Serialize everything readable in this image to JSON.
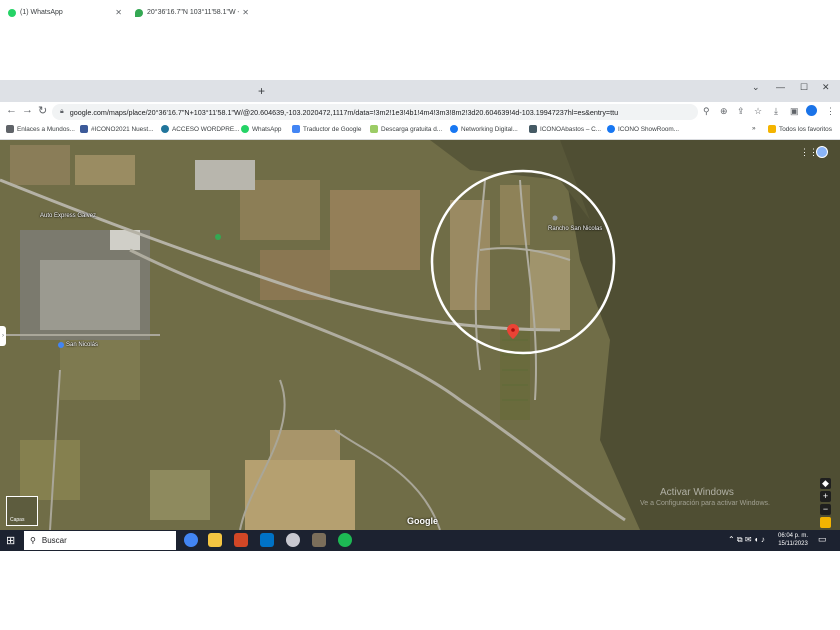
{
  "browser": {
    "tabs": [
      {
        "label": "(1) WhatsApp",
        "color": "#25d366"
      },
      {
        "label": "20°36'16.7\"N 103°11'58.1\"W - G",
        "color": "#34a853"
      }
    ],
    "url": "google.com/maps/place/20°36'16.7\"N+103°11'58.1\"W/@20.604639,-103.2020472,1117m/data=!3m2!1e3!4b1!4m4!3m3!8m2!3d20.604639!4d-103.19947237hl=es&entry=ttu",
    "bookmarks": [
      {
        "label": "Enlaces a Mundos...",
        "color": "#5f6368"
      },
      {
        "label": "#ICONO2021 Nuest...",
        "color": "#3c5a99"
      },
      {
        "label": "ACCESO WORDPRE...",
        "color": "#21759b"
      },
      {
        "label": "WhatsApp",
        "color": "#25d366"
      },
      {
        "label": "Traductor de Google",
        "color": "#4285f4"
      },
      {
        "label": "Descarga gratuita d...",
        "color": "#9ccc65"
      },
      {
        "label": "Networking Digital...",
        "color": "#1877f2"
      },
      {
        "label": "ICONOAbastos – C...",
        "color": "#455a64"
      },
      {
        "label": "ICONO ShowRoom...",
        "color": "#1877f2"
      },
      {
        "label": "Todos los favoritos",
        "color": "#f4b400"
      }
    ]
  },
  "map": {
    "labels": {
      "place1": "Auto Express Galvez",
      "place2": "Rancho San Nicolas",
      "place3": "San Nicolás"
    },
    "watermark_line1": "Activar Windows",
    "watermark_line2": "Ve a Configuración para activar Windows.",
    "google": "Google",
    "layers_label": "Capas",
    "zoom_in": "+",
    "zoom_out": "−"
  },
  "taskbar": {
    "search_label": "Buscar",
    "time": "06:04 p. m.",
    "date": "15/11/2023"
  }
}
